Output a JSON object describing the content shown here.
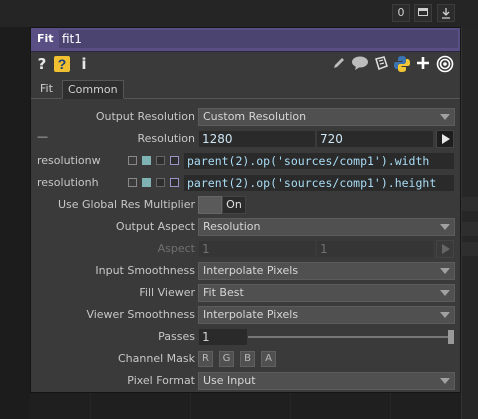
{
  "topbar": {
    "button_zero": "0",
    "button_maximize": "",
    "button_download": ""
  },
  "header": {
    "op_type": "Fit",
    "op_name": "fit1"
  },
  "toolbar": {
    "icons": [
      "help-icon",
      "python-help-icon",
      "info-icon",
      "edit-icon",
      "comment-icon",
      "clone-icon",
      "python-icon",
      "add-icon",
      "target-icon"
    ],
    "help_glyph": "?",
    "info_glyph": "i"
  },
  "tabs": [
    {
      "label": "Fit",
      "active": false
    },
    {
      "label": "Common",
      "active": true
    }
  ],
  "params": {
    "output_resolution": {
      "label": "Output Resolution",
      "value": "Custom Resolution"
    },
    "resolution": {
      "label": "Resolution",
      "prefix": "—",
      "w": "1280",
      "h": "720"
    },
    "resolutionw": {
      "label": "resolutionw",
      "expr": "parent(2).op('sources/comp1').width"
    },
    "resolutionh": {
      "label": "resolutionh",
      "expr": "parent(2).op('sources/comp1').height"
    },
    "global_res": {
      "label": "Use Global Res Multiplier",
      "value": "On"
    },
    "output_aspect": {
      "label": "Output Aspect",
      "value": "Resolution"
    },
    "aspect": {
      "label": "Aspect",
      "a": "1",
      "b": "1"
    },
    "input_smoothness": {
      "label": "Input Smoothness",
      "value": "Interpolate Pixels"
    },
    "fill_viewer": {
      "label": "Fill Viewer",
      "value": "Fit Best"
    },
    "viewer_smoothness": {
      "label": "Viewer Smoothness",
      "value": "Interpolate Pixels"
    },
    "passes": {
      "label": "Passes",
      "value": "1"
    },
    "channel_mask": {
      "label": "Channel Mask",
      "channels": [
        "R",
        "G",
        "B",
        "A"
      ]
    },
    "pixel_format": {
      "label": "Pixel Format",
      "value": "Use Input"
    }
  },
  "colors": {
    "title_bg": "#5a4f84",
    "expr_text": "#a9ddf7",
    "mode_teal": "#7fb3b3",
    "mode_lavender": "#9a94c8"
  }
}
